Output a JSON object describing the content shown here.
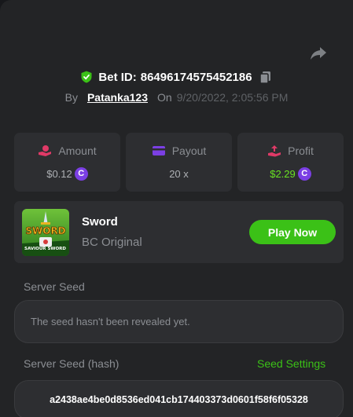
{
  "header": {
    "bet_label": "Bet ID:",
    "bet_id": "86496174575452186",
    "by_label": "By",
    "username": "Patanka123",
    "on_label": "On",
    "datetime": "9/20/2022, 2:05:56 PM"
  },
  "stats": [
    {
      "label": "Amount",
      "value": "$0.12",
      "icon": "money-hand-icon"
    },
    {
      "label": "Payout",
      "value": "20 x",
      "icon": "card-icon"
    },
    {
      "label": "Profit",
      "value": "$2.29",
      "icon": "profit-hand-icon"
    }
  ],
  "coin_symbol": "C",
  "game": {
    "name": "Sword",
    "provider": "BC Original",
    "play_label": "Play Now",
    "thumb_title": "SWORD",
    "thumb_caption": "SAVIOUR SWORD"
  },
  "server_seed": {
    "label": "Server Seed",
    "value": "The seed hasn't been revealed yet."
  },
  "server_seed_hash": {
    "label": "Server Seed (hash)",
    "settings_label": "Seed Settings",
    "value": "a2438ae4be0d8536ed041cb174403373d0601f58f6f05328"
  },
  "colors": {
    "accent_green": "#3bc117",
    "profit_green": "#6ae322",
    "coin_purple": "#7b3fe4",
    "panel_bg": "#232426",
    "card_bg": "#2d2e31"
  }
}
